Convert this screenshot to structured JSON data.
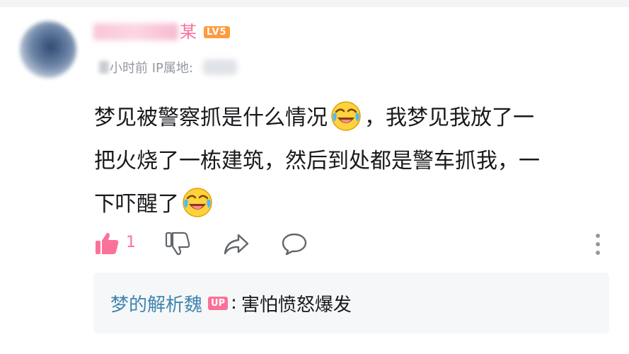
{
  "user": {
    "name_suffix": "某",
    "level_badge": "LV5"
  },
  "meta": {
    "time_text": "小时前 IP属地:"
  },
  "comment": {
    "line1_a": "梦见被警察抓是什么情况",
    "line1_b": "，我梦见我放了一",
    "line2": "把火烧了一栋建筑，然后到处都是警车抓我，一",
    "line3": "下吓醒了",
    "emoji_name": "laughing-crying-emoji"
  },
  "actions": {
    "like_count": "1",
    "icons": [
      "thumbs-up-icon",
      "thumbs-down-icon",
      "share-icon",
      "reply-icon",
      "more-icon"
    ]
  },
  "reply_preview": {
    "author": "梦的解析魏",
    "badge": "UP",
    "separator": ":",
    "text": "害怕愤怒爆发"
  },
  "colors": {
    "accent_pink": "#fb7299",
    "reply_name_blue": "#3f85b0",
    "level_orange": "#ff9b3f",
    "meta_gray": "#9499a0"
  }
}
